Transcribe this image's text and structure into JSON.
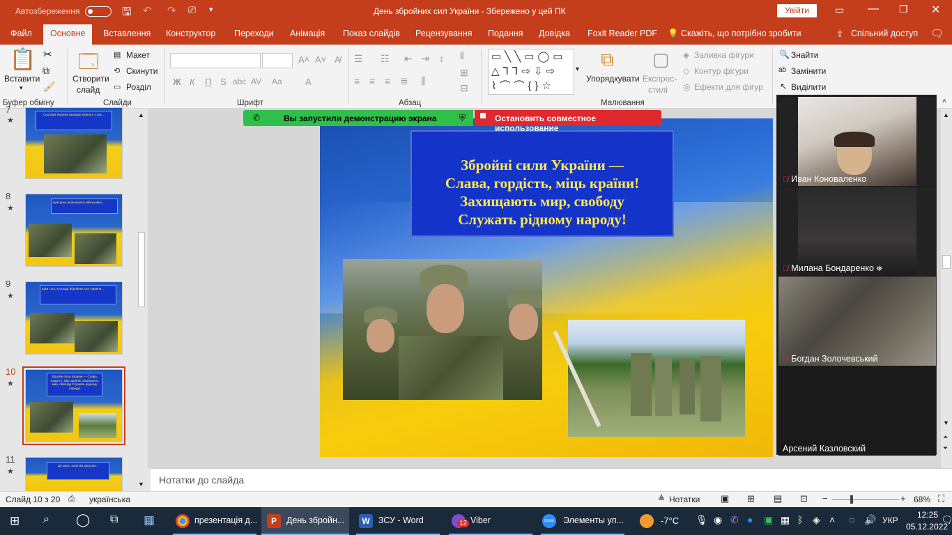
{
  "titlebar": {
    "autosave_label": "Автозбереження",
    "autosave_state": "Вимк.",
    "doc_title": "День збройних сил України  -  Збережено у цей ПК",
    "signin_label": "Увійти"
  },
  "tabs": [
    {
      "label": "Файл"
    },
    {
      "label": "Основне"
    },
    {
      "label": "Вставлення"
    },
    {
      "label": "Конструктор"
    },
    {
      "label": "Переходи"
    },
    {
      "label": "Анімація"
    },
    {
      "label": "Показ слайдів"
    },
    {
      "label": "Рецензування"
    },
    {
      "label": "Подання"
    },
    {
      "label": "Довідка"
    },
    {
      "label": "Foxit Reader PDF"
    },
    {
      "label": "Скажіть, що потрібно зробити"
    }
  ],
  "share_label": "Спільний доступ",
  "ribbon": {
    "paste": "Вставити",
    "new_slide_1": "Створити",
    "new_slide_2": "слайд",
    "layout": "Макет",
    "reset": "Скинути",
    "section": "Розділ",
    "arrange": "Упорядкувати",
    "quick_styles_1": "Експрес-",
    "quick_styles_2": "стилі",
    "shape_fill": "Заливка фігури",
    "shape_outline": "Контур фігури",
    "shape_effects": "Ефекти для фігур",
    "find": "Знайти",
    "replace": "Замінити",
    "select": "Виділити",
    "groups": {
      "clipboard": "Буфер обміну",
      "slides": "Слайди",
      "font": "Шрифт",
      "paragraph": "Абзац",
      "drawing": "Малювання"
    }
  },
  "thumbnails": [
    {
      "num": "7",
      "text": "Сьогодні Україна захищає кожного з нас..."
    },
    {
      "num": "8",
      "text": "Цей день вшановують військових..."
    },
    {
      "num": "9",
      "text": "Крім того, в складі Збройних сил України..."
    },
    {
      "num": "10",
      "text": "Збройні сили України — Слава, гордість, міць країни! Захищають мир, свободу Служать рідному народу!"
    },
    {
      "num": "11",
      "text": "Це день, коли ми дякуємо..."
    }
  ],
  "slide": {
    "title_lines": [
      "Збройні сили України —",
      "Слава, гордість, міць країни!",
      "Захищають мир, свободу",
      "Служать рідному народу!"
    ]
  },
  "screenshare": {
    "started": "Вы запустили демонстрацию экрана",
    "stop": "Остановить совместное использование"
  },
  "participants": [
    {
      "name": "Иван Коноваленко"
    },
    {
      "name": "Милана Бондаренко"
    },
    {
      "name": "Богдан Золочевський"
    },
    {
      "name": "Арсений Казловский"
    }
  ],
  "notes_placeholder": "Нотатки до слайда",
  "status": {
    "slide_info": "Слайд 10 з 20",
    "language": "українська",
    "notes_btn": "Нотатки",
    "zoom": "68%"
  },
  "taskbar": {
    "items": [
      {
        "label": "презентація д..."
      },
      {
        "label": "День збройн..."
      },
      {
        "label": "ЗСУ - Word"
      },
      {
        "label": "Viber"
      },
      {
        "label": "Элементы уп..."
      }
    ],
    "viber_badge": "12",
    "weather": "-7°C",
    "lang": "УКР",
    "time": "12:25",
    "date": "05.12.2022"
  },
  "colors": {
    "accent": "#c43e1c",
    "share_green": "#2fbf4a",
    "share_red": "#e0282f",
    "slide_text": "#ffe94a",
    "slide_box": "#1434c9"
  }
}
